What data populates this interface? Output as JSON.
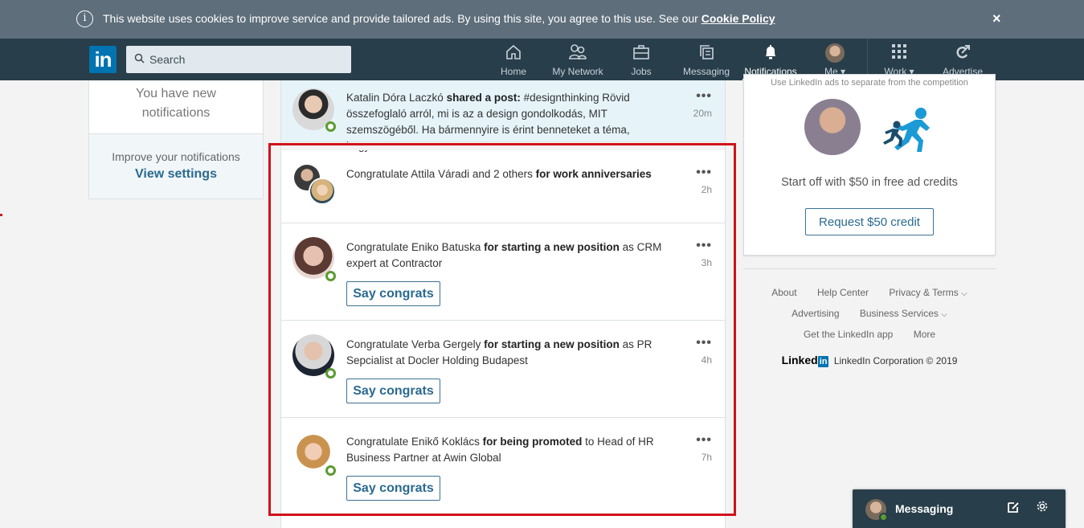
{
  "cookie_bar": {
    "message": "This website uses cookies to improve service and provide tailored ads. By using this site, you agree to this use. See our ",
    "link": "Cookie Policy",
    "info_icon": "ⓘ",
    "close_icon": "×"
  },
  "navbar": {
    "logo": "in",
    "search_placeholder": "Search",
    "search_icon": "⚲",
    "items": [
      {
        "label": "Home",
        "icon": "⌂"
      },
      {
        "label": "My Network",
        "icon": "👥"
      },
      {
        "label": "Jobs",
        "icon": "💼"
      },
      {
        "label": "Messaging",
        "icon": "🗨"
      },
      {
        "label": "Notifications",
        "icon": "🔔",
        "active": true
      },
      {
        "label": "Me ▾"
      },
      {
        "label": "Work ▾",
        "icon": "⠿"
      },
      {
        "label": "Advertise",
        "icon": "➹"
      }
    ]
  },
  "left_panel": {
    "new_notifications": "You have new notifications",
    "improve_text": "Improve your notifications",
    "view_settings": "View settings"
  },
  "notifications": [
    {
      "name": "Katalin Dóra Laczkó",
      "action": "shared a post:",
      "rest": " #designthinking Rövid összefoglaló arról, mi is az a design gondolkodás, MIT szemszögéből. Ha bármennyire is érint benneteket a téma, hogyan",
      "time": "20m",
      "unread": true
    },
    {
      "prefix": "Congratulate Attila Váradi and 2 others ",
      "action": "for work anniversaries",
      "rest": "",
      "time": "2h"
    },
    {
      "prefix": "Congratulate Eniko Batuska ",
      "action": "for starting a new position",
      "rest": " as CRM expert at Contractor",
      "time": "3h",
      "button": "Say congrats"
    },
    {
      "prefix": "Congratulate Verba Gergely ",
      "action": "for starting a new position",
      "rest": " as PR Sepcialist at Docler Holding Budapest",
      "time": "4h",
      "button": "Say congrats"
    },
    {
      "prefix": "Congratulate Enikő Koklács ",
      "action": "for being promoted",
      "rest": " to Head of HR Business Partner at Awin Global",
      "time": "7h",
      "button": "Say congrats"
    }
  ],
  "more_icon": "•••",
  "ad": {
    "subtitle": "Use LinkedIn ads to separate from the competition",
    "headline": "Start off with $50 in free ad credits",
    "button": "Request $50 credit"
  },
  "footer": {
    "row1": [
      "About",
      "Help Center",
      "Privacy & Terms"
    ],
    "row2": [
      "Advertising",
      "Business Services"
    ],
    "row3": [
      "Get the LinkedIn app",
      "More"
    ],
    "chevron": "⌄",
    "wordmark": "Linked",
    "wordmark_in": "in",
    "copyright": "LinkedIn Corporation © 2019"
  },
  "messaging": {
    "label": "Messaging",
    "compose_icon": "✎",
    "settings_icon": "⚙"
  },
  "colors": {
    "brand": "#0073b1",
    "nav_bg": "#283e4a",
    "cookie_bg": "#5e6e7b",
    "link": "#2a6a8f",
    "highlight": "#d0121b",
    "online": "#5b9b30",
    "unread_bg": "#e6f4fa"
  }
}
